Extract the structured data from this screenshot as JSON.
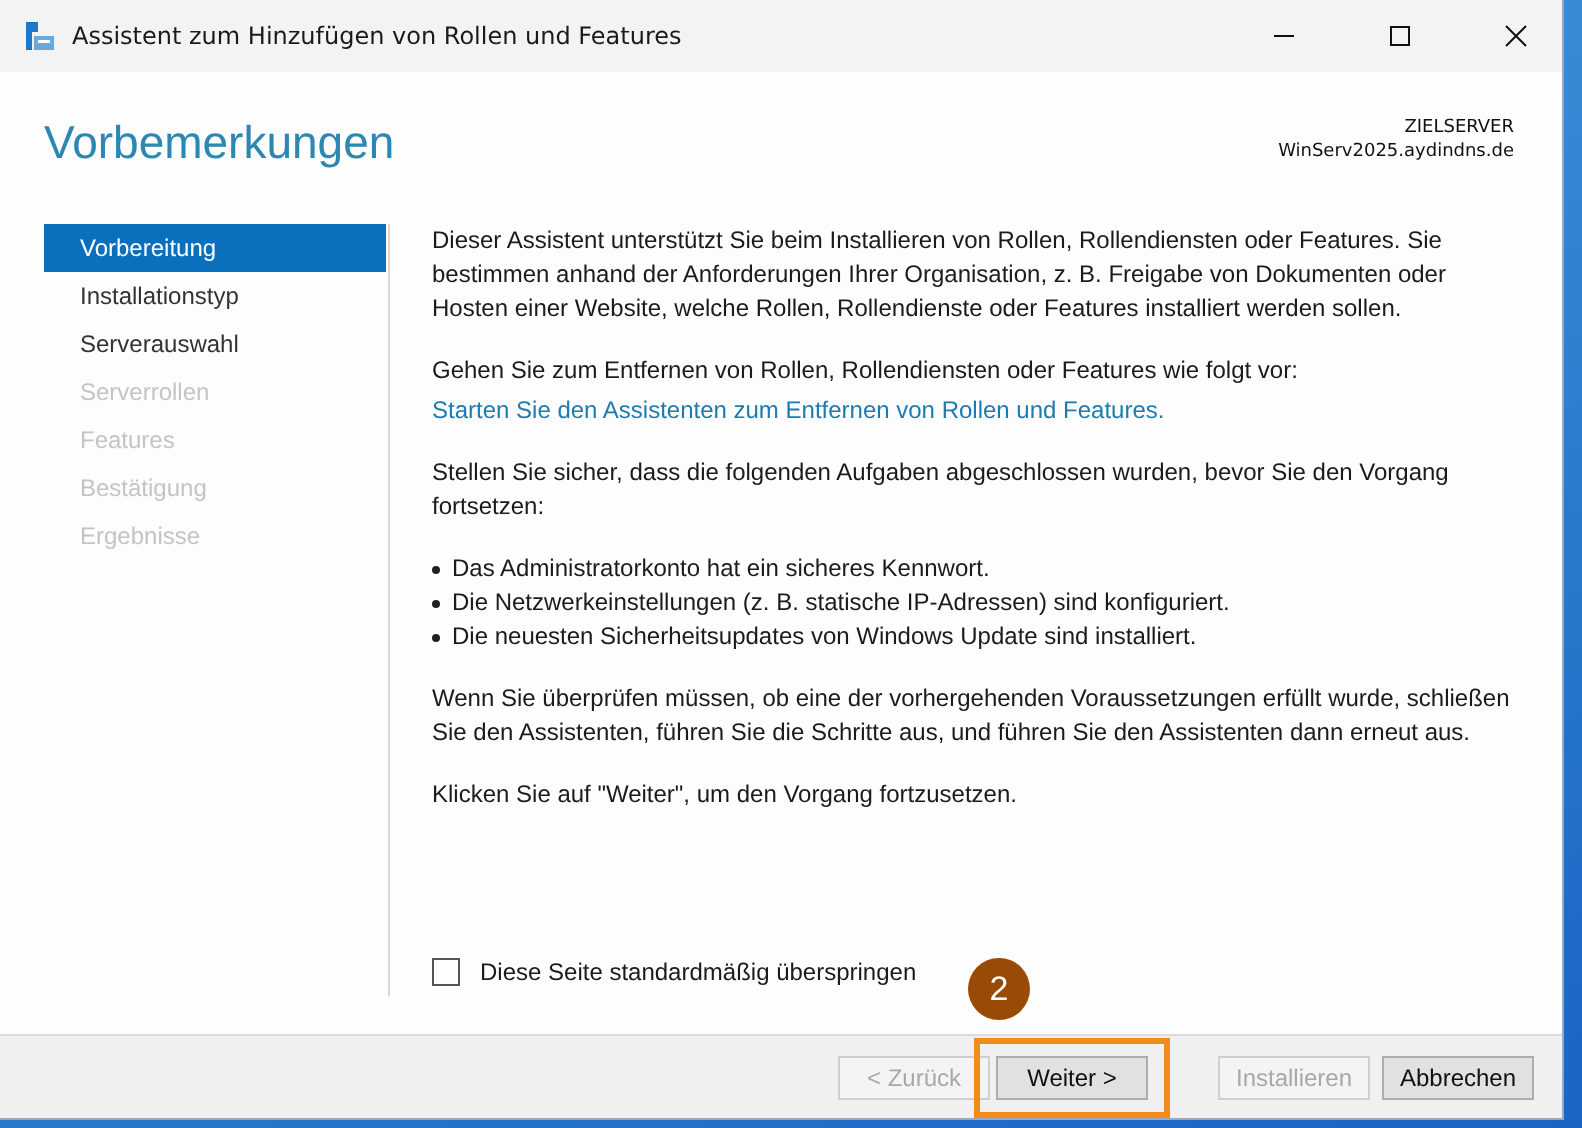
{
  "window": {
    "title": "Assistent zum Hinzufügen von Rollen und Features"
  },
  "header": {
    "title": "Vorbemerkungen",
    "server_label": "ZIELSERVER",
    "server_name": "WinServ2025.aydindns.de"
  },
  "sidebar": {
    "items": [
      {
        "label": "Vorbereitung",
        "selected": true,
        "disabled": false
      },
      {
        "label": "Installationstyp",
        "selected": false,
        "disabled": false
      },
      {
        "label": "Serverauswahl",
        "selected": false,
        "disabled": false
      },
      {
        "label": "Serverrollen",
        "selected": false,
        "disabled": true
      },
      {
        "label": "Features",
        "selected": false,
        "disabled": true
      },
      {
        "label": "Bestätigung",
        "selected": false,
        "disabled": true
      },
      {
        "label": "Ergebnisse",
        "selected": false,
        "disabled": true
      }
    ]
  },
  "content": {
    "blocks": [
      {
        "kind": "paragraph",
        "text": "Dieser Assistent unterstützt Sie beim Installieren von Rollen, Rollendiensten oder Features. Sie bestimmen anhand der Anforderungen Ihrer Organisation, z. B. Freigabe von Dokumenten oder Hosten einer Website, welche Rollen, Rollendienste oder Features installiert werden sollen."
      },
      {
        "kind": "paragraph_link",
        "text": "Gehen Sie zum Entfernen von Rollen, Rollendiensten oder Features wie folgt vor:",
        "link": "Starten Sie den Assistenten zum Entfernen von Rollen und Features."
      },
      {
        "kind": "paragraph",
        "text": "Stellen Sie sicher, dass die folgenden Aufgaben abgeschlossen wurden, bevor Sie den Vorgang fortsetzen:"
      },
      {
        "kind": "bullets",
        "items": [
          "Das Administratorkonto hat ein sicheres Kennwort.",
          "Die Netzwerkeinstellungen (z. B. statische IP-Adressen) sind konfiguriert.",
          "Die neuesten Sicherheitsupdates von Windows Update sind installiert."
        ]
      },
      {
        "kind": "paragraph",
        "text": "Wenn Sie überprüfen müssen, ob eine der vorhergehenden Voraussetzungen erfüllt wurde, schließen Sie den Assistenten, führen Sie die Schritte aus, und führen Sie den Assistenten dann erneut aus."
      },
      {
        "kind": "paragraph",
        "text": "Klicken Sie auf \"Weiter\", um den Vorgang fortzusetzen."
      }
    ],
    "skip_checkbox": {
      "label": "Diese Seite standardmäßig überspringen",
      "checked": false
    }
  },
  "annotation": {
    "number": "2"
  },
  "buttons": [
    {
      "label": "< Zurück",
      "disabled": true,
      "highlighted": false
    },
    {
      "label": "Weiter >",
      "disabled": false,
      "highlighted": true
    },
    {
      "label": "Installieren",
      "disabled": true,
      "highlighted": false
    },
    {
      "label": "Abbrechen",
      "disabled": false,
      "highlighted": false
    }
  ]
}
